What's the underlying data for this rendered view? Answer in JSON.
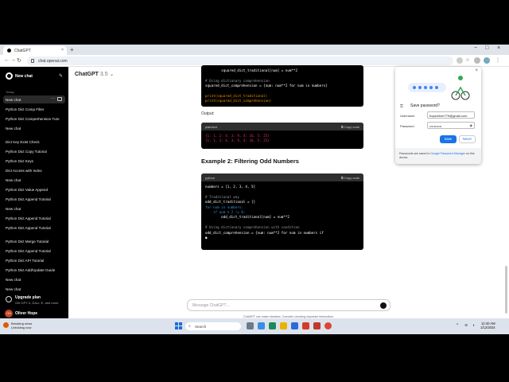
{
  "browser": {
    "tab_title": "ChatGPT",
    "tab_close": "×",
    "new_tab": "+",
    "url": "chat.openai.com",
    "back": "←",
    "forward": "→",
    "reload": "↻",
    "home": "⌂",
    "window_controls": [
      "−",
      "□",
      "×"
    ]
  },
  "sidebar": {
    "new_chat": "New chat",
    "section_today": "Today",
    "items": [
      "New chat",
      "Python Dict Comp Filter",
      "Python Dict Comprehension Tuto",
      "New chat",
      "Dict Key Exist Check",
      "Python Dict Copy Tutorial",
      "Python Dict Keys",
      "Dict Access with Index",
      "New chat",
      "Python Dict Value Append",
      "Python Dict Append Tutorial",
      "New chat",
      "Python Dict Append Tutorial",
      "Python Dict Append Tutorial",
      "Python Dict Merge Tutorial",
      "Python Dict Append Tutorial",
      "Python Dict API Tutorial",
      "Python Dict Add/Update Guide",
      "New chat",
      "New chat"
    ],
    "active_dots": "···",
    "upgrade_title": "Upgrade plan",
    "upgrade_sub": "Get GPT-4, DALL·E, and more",
    "user_initials": "OH",
    "user_name": "Oliver Hope"
  },
  "main": {
    "model_name": "ChatGPT",
    "model_version": "3.5",
    "output_label": "Output:",
    "example_heading": "Example 2: Filtering Odd Numbers",
    "copy_code": "Copy code",
    "lang_python": "python",
    "lang_plain": "plaintext",
    "input_placeholder": "Message ChatGPT…",
    "disclaimer": "ChatGPT can make mistakes. Consider checking important information."
  },
  "code1": [
    "        squared_dict_traditional[num] = num**2",
    "",
    "# Using dictionary comprehension",
    "squared_dict_comprehension = {num: num**2 for num in numbers}",
    "",
    "print(squared_dict_traditional)",
    "print(squared_dict_comprehension)"
  ],
  "output": [
    "{1: 1, 2: 4, 3: 9, 4: 16, 5: 25}",
    "{1: 1, 2: 4, 3: 9, 4: 16, 5: 25}"
  ],
  "code2": [
    "numbers = [1, 2, 3, 4, 5]",
    "",
    "# Traditional way",
    "odd_dict_traditional = {}",
    "for num in numbers:",
    "    if num % 2 != 0:",
    "        odd_dict_traditional[num] = num**2",
    "",
    "# Using dictionary comprehension with condition",
    "odd_dict_comprehension = {num: num**2 for num in numbers if"
  ],
  "password_popup": {
    "title": "Save password?",
    "username_label": "Username",
    "username_value": "hopeoliver779@gmail.com",
    "password_label": "Password",
    "password_value": "•••••••••••",
    "save": "Save",
    "never": "Never",
    "footer_pre": "Passwords are saved to ",
    "footer_link": "Google Password Manager",
    "footer_post": " on this device."
  },
  "taskbar": {
    "news_title": "Breaking news",
    "news_sub": "Unfolding now",
    "search": "Search",
    "time": "12:40 AM",
    "date": "1/12/2024"
  },
  "colors": {
    "sidebar_bg": "#000000",
    "accent_blue": "#1a73e8",
    "code_bg": "#000000"
  }
}
